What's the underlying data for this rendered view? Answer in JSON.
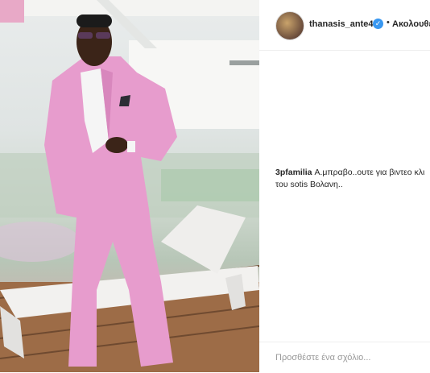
{
  "post": {
    "image_alt_icon": "photo-of-man-in-pink-suit"
  },
  "header": {
    "username": "thanasis_ante43",
    "verified_icon": "verified-badge-icon",
    "separator": "•",
    "follow_label": "Ακολουθε"
  },
  "comment": {
    "author": "3pfamilia",
    "text_line1": " Α.μπραβο..ουτε για βιντεο κλι",
    "text_line2": "του sotis Βολανη.."
  },
  "add_comment": {
    "placeholder": "Προσθέστε ένα σχόλιο..."
  },
  "colors": {
    "suit_pink": "#e79ccd",
    "verified_blue": "#3897f0",
    "text": "#262626"
  }
}
